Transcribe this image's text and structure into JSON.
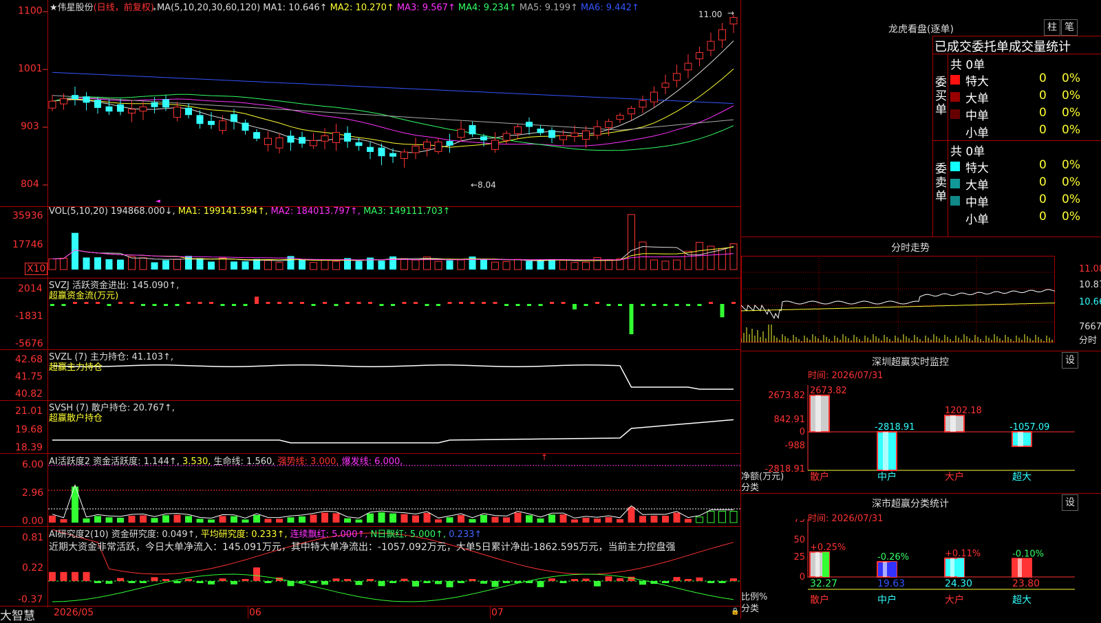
{
  "stock": {
    "star": "★",
    "name": "伟星股份",
    "mode": "(日线，前复权)",
    "ma_label": "MA(5,10,20,30,60,120)",
    "ma": [
      {
        "label": "MA1:",
        "value": "10.646↑",
        "color": "#dddddd"
      },
      {
        "label": "MA2:",
        "value": "10.270↑",
        "color": "#ffff33"
      },
      {
        "label": "MA3:",
        "value": "9.567↑",
        "color": "#ff33ff"
      },
      {
        "label": "MA4:",
        "value": "9.234↑",
        "color": "#33ff66"
      },
      {
        "label": "MA5:",
        "value": "9.199↑",
        "color": "#aaaaaa"
      },
      {
        "label": "MA6:",
        "value": "9.442↑",
        "color": "#3355ff"
      }
    ],
    "price_axis": [
      "1100",
      "1001",
      "903",
      "804"
    ],
    "high_label": "11.00",
    "low_label": "←8.04"
  },
  "vol": {
    "title": "VOL(5,10,20)",
    "value": "194868.000↓,",
    "ma1": "MA1: 199141.594↑,",
    "ma2": "MA2: 184013.797↑,",
    "ma3": "MA3: 149111.703↑",
    "axis": [
      "35936",
      "17746"
    ],
    "unit": "X10"
  },
  "svzj": {
    "title": "SVZJ  活跃资金进出: 145.090↑,",
    "sub": "超赢资金流(万元)",
    "axis": [
      "2014",
      "-1831",
      "-5676"
    ]
  },
  "svzl": {
    "title": "SVZL (7) 主力持仓: 41.103↑,",
    "sub": "超赢主力持仓",
    "axis": [
      "42.68",
      "41.75",
      "40.82"
    ]
  },
  "svsh": {
    "title": "SVSH (7) 散户持仓: 20.767↑,",
    "sub": "超赢散户持仓",
    "axis": [
      "21.01",
      "19.68",
      "18.39"
    ]
  },
  "ai_active": {
    "title": "AI活跃度2 资金活跃度: 1.144↑,",
    "v2": "3.530,",
    "life": "生命线: 1.560,",
    "strong": "强势线: 3.000,",
    "burst": "爆发线: 6.000,",
    "axis": [
      "6.00",
      "2.96",
      "0.00"
    ]
  },
  "ai_research": {
    "title": "AI研究度2(10) 资金研究度: 0.049↑,",
    "avg": "平均研究度: 0.233↑,",
    "cont": "连续飘红: 5.000↑,",
    "nday": "N日飘红: 5.000↑,",
    "last": "0.233↑",
    "comment": "近期大资金非常活跃，今日大单净流入：145.091万元，其中特大单净流出：-1057.092万元，大单5日累计净出-1862.595万元，当前主力控盘强",
    "axis": [
      "0.81",
      "0.22",
      "-0.37"
    ]
  },
  "footer": {
    "brand": "大智慧",
    "dates": [
      "2026/05",
      "06",
      "07"
    ]
  },
  "lhkp": {
    "title": "龙虎看盘(逐单)",
    "btn1": "柱",
    "btn2": "笔",
    "header": "已成交委托单成交量统计",
    "buy_side": "委买单",
    "sell_side": "委卖单",
    "buy_total": "共 0单",
    "sell_total": "共 0单",
    "rows_buy": [
      {
        "label": "特大",
        "n": "0",
        "pct": "0%",
        "color": "#ff1111"
      },
      {
        "label": "大单",
        "n": "0",
        "pct": "0%",
        "color": "#990000"
      },
      {
        "label": "中单",
        "n": "0",
        "pct": "0%",
        "color": "#660000"
      },
      {
        "label": "小单",
        "n": "0",
        "pct": "0%",
        "color": ""
      }
    ],
    "rows_sell": [
      {
        "label": "特大",
        "n": "0",
        "pct": "0%",
        "color": "#11ffff"
      },
      {
        "label": "大单",
        "n": "0",
        "pct": "0%",
        "color": "#119999"
      },
      {
        "label": "中单",
        "n": "0",
        "pct": "0%",
        "color": "#118888"
      },
      {
        "label": "小单",
        "n": "0",
        "pct": "0%",
        "color": ""
      }
    ]
  },
  "fenshi": {
    "title": "分时走势",
    "axis": [
      "11.08",
      "10.87",
      "10.66"
    ],
    "vol": "7667",
    "vol_unit": "分时"
  },
  "monitor": {
    "title": "深圳超赢实时监控",
    "btn": "设",
    "time": "时间: 2026/07/31",
    "axis": [
      "2673.82",
      "842.91",
      "0",
      "-988",
      "-2818.91"
    ],
    "ylabel1": "净额(万元)",
    "ylabel2": "分类",
    "cats": [
      "散户",
      "中户",
      "大户",
      "超大"
    ],
    "values_text": [
      "2673.82",
      "-2818.91",
      "1202.18",
      "-1057.09"
    ]
  },
  "classify": {
    "title": "深市超赢分类统计",
    "btn": "设",
    "time": "时间: 2026/07/31",
    "axis": [
      "75",
      "50",
      "25",
      "0"
    ],
    "ylabel1": "比例%",
    "ylabel2": "分类",
    "cats": [
      "散户",
      "中户",
      "大户",
      "超大"
    ],
    "pct_labels": [
      "+0.25%",
      "-0.26%",
      "+0.11%",
      "-0.10%"
    ],
    "values_text": [
      "32.27",
      "19.63",
      "24.30",
      "23.80"
    ]
  }
}
